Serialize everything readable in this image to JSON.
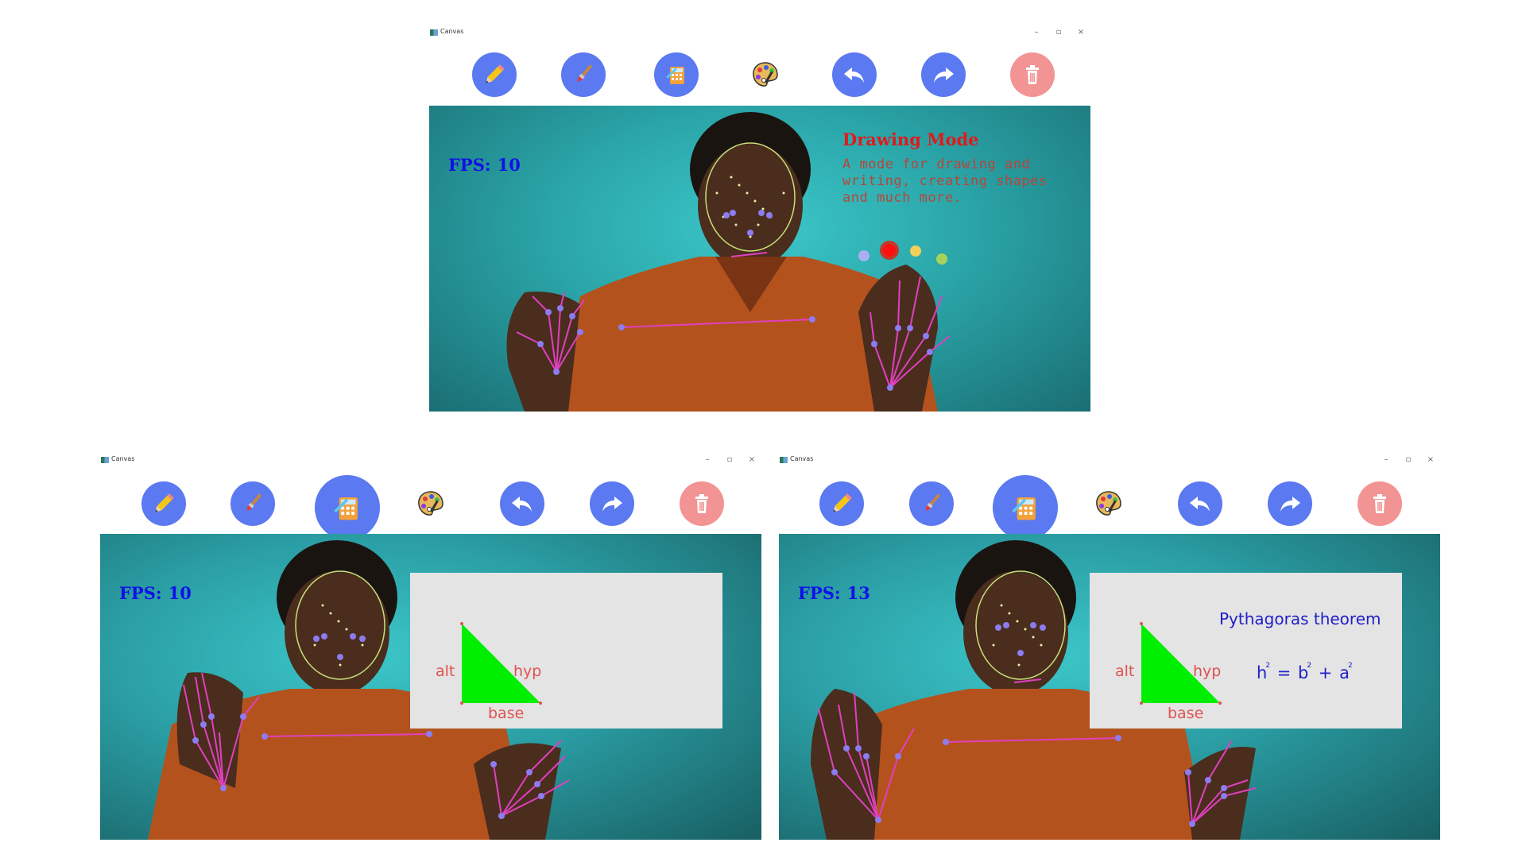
{
  "windows": [
    {
      "title": "Canvas",
      "controls": {
        "minimize": "–",
        "maximize": "▫",
        "close": "×"
      },
      "toolbar": [
        {
          "name": "pencil-tool-button",
          "icon": "pencil-icon",
          "color": "#5b79f0",
          "active": false
        },
        {
          "name": "brush-tool-button",
          "icon": "brush-icon",
          "color": "#5b79f0",
          "active": false
        },
        {
          "name": "calculator-tool-button",
          "icon": "calculator-icon",
          "color": "#5b79f0",
          "active": false
        },
        {
          "name": "palette-tool-button",
          "icon": "palette-icon",
          "color": "none",
          "active": false
        },
        {
          "name": "undo-button",
          "icon": "undo-icon",
          "color": "#5b79f0",
          "active": false
        },
        {
          "name": "redo-button",
          "icon": "redo-icon",
          "color": "#5b79f0",
          "active": false
        },
        {
          "name": "delete-button",
          "icon": "trash-icon",
          "color": "#f29494",
          "active": false
        }
      ],
      "camera": {
        "fps_label": "FPS:",
        "fps_value": "10",
        "mode_title": "Drawing Mode",
        "mode_description": "A mode for drawing and writing, creating shapes and much more.",
        "color_dots": [
          "#a9b0ef",
          "#ff1010",
          "#f2d05a",
          "#a8d25a"
        ],
        "selected_color": "#ff1010"
      }
    },
    {
      "title": "Canvas",
      "controls": {
        "minimize": "–",
        "maximize": "▫",
        "close": "×"
      },
      "toolbar": [
        {
          "name": "pencil-tool-button",
          "icon": "pencil-icon",
          "color": "#5b79f0",
          "active": false
        },
        {
          "name": "brush-tool-button",
          "icon": "brush-icon",
          "color": "#5b79f0",
          "active": false
        },
        {
          "name": "calculator-tool-button",
          "icon": "calculator-icon",
          "color": "#5b79f0",
          "active": true
        },
        {
          "name": "palette-tool-button",
          "icon": "palette-icon",
          "color": "none",
          "active": false
        },
        {
          "name": "undo-button",
          "icon": "undo-icon",
          "color": "#5b79f0",
          "active": false
        },
        {
          "name": "redo-button",
          "icon": "redo-icon",
          "color": "#5b79f0",
          "active": false
        },
        {
          "name": "delete-button",
          "icon": "trash-icon",
          "color": "#f29494",
          "active": false
        }
      ],
      "camera": {
        "fps_label": "FPS:",
        "fps_value": "10",
        "panel": {
          "alt": "alt",
          "hyp": "hyp",
          "base": "base",
          "triangle_color": "#00ee00"
        }
      }
    },
    {
      "title": "Canvas",
      "controls": {
        "minimize": "–",
        "maximize": "▫",
        "close": "×"
      },
      "toolbar": [
        {
          "name": "pencil-tool-button",
          "icon": "pencil-icon",
          "color": "#5b79f0",
          "active": false
        },
        {
          "name": "brush-tool-button",
          "icon": "brush-icon",
          "color": "#5b79f0",
          "active": false
        },
        {
          "name": "calculator-tool-button",
          "icon": "calculator-icon",
          "color": "#5b79f0",
          "active": true
        },
        {
          "name": "palette-tool-button",
          "icon": "palette-icon",
          "color": "none",
          "active": false
        },
        {
          "name": "undo-button",
          "icon": "undo-icon",
          "color": "#5b79f0",
          "active": false
        },
        {
          "name": "redo-button",
          "icon": "redo-icon",
          "color": "#5b79f0",
          "active": false
        },
        {
          "name": "delete-button",
          "icon": "trash-icon",
          "color": "#f29494",
          "active": false
        }
      ],
      "camera": {
        "fps_label": "FPS:",
        "fps_value": "13",
        "panel": {
          "alt": "alt",
          "hyp": "hyp",
          "base": "base",
          "triangle_color": "#00ee00",
          "theorem_title": "Pythagoras theorem",
          "formula": {
            "h": "h",
            "b": "b",
            "a": "a",
            "exp": "2",
            "eq": "=",
            "plus": "+"
          }
        }
      }
    }
  ]
}
